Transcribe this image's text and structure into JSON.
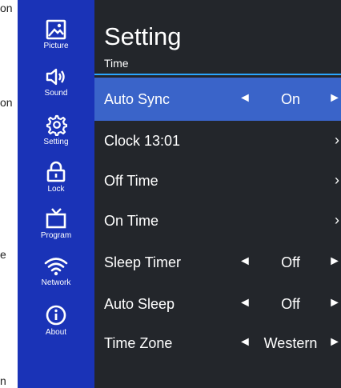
{
  "edge_texts": [
    "on",
    "on",
    "e",
    "n"
  ],
  "nav": [
    {
      "label": "Picture",
      "icon": "picture-icon"
    },
    {
      "label": "Sound",
      "icon": "sound-icon"
    },
    {
      "label": "Setting",
      "icon": "gear-icon"
    },
    {
      "label": "Lock",
      "icon": "lock-icon"
    },
    {
      "label": "Program",
      "icon": "tv-icon"
    },
    {
      "label": "Network",
      "icon": "wifi-icon"
    },
    {
      "label": "About",
      "icon": "info-icon"
    }
  ],
  "panel": {
    "title": "Setting",
    "subtitle": "Time",
    "rows": [
      {
        "label": "Auto Sync",
        "value": "On",
        "left_arrow": "◄",
        "right_arrow": "►",
        "selected": true
      },
      {
        "label": "Clock 13:01",
        "chevron": "›"
      },
      {
        "label": "Off Time",
        "chevron": "›"
      },
      {
        "label": "On Time",
        "chevron": "›"
      },
      {
        "label": "Sleep Timer",
        "value": "Off",
        "left_arrow": "◄",
        "right_arrow": "►"
      },
      {
        "label": "Auto Sleep",
        "value": "Off",
        "left_arrow": "◄",
        "right_arrow": "►"
      },
      {
        "label": "Time Zone",
        "value": "Western",
        "left_arrow": "◄",
        "right_arrow": "►"
      }
    ]
  },
  "colors": {
    "sidebar": "#1a33b7",
    "panel": "#23262b",
    "selected_row": "#3a64c9",
    "accent_rule": "#2aa6ff"
  }
}
